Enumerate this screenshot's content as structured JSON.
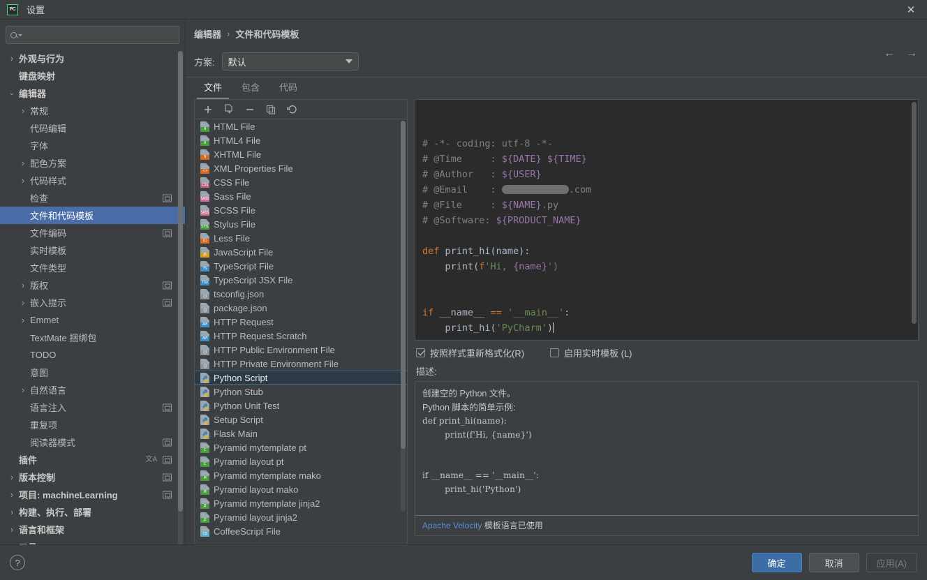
{
  "window": {
    "title": "设置",
    "app_icon": "PC",
    "close_icon": "✕"
  },
  "sidebar": {
    "search": {
      "placeholder": "",
      "value": "",
      "icon": "search-icon"
    },
    "items": [
      {
        "label": "外观与行为",
        "indent": 0,
        "arrow": "▶",
        "bold": true,
        "badge": false
      },
      {
        "label": "键盘映射",
        "indent": 0,
        "arrow": "",
        "bold": true,
        "badge": false
      },
      {
        "label": "编辑器",
        "indent": 0,
        "arrow": "▼",
        "bold": true,
        "badge": false
      },
      {
        "label": "常规",
        "indent": 1,
        "arrow": "▶",
        "bold": false,
        "badge": false
      },
      {
        "label": "代码编辑",
        "indent": 1,
        "arrow": "",
        "bold": false,
        "badge": false
      },
      {
        "label": "字体",
        "indent": 1,
        "arrow": "",
        "bold": false,
        "badge": false
      },
      {
        "label": "配色方案",
        "indent": 1,
        "arrow": "▶",
        "bold": false,
        "badge": false
      },
      {
        "label": "代码样式",
        "indent": 1,
        "arrow": "▶",
        "bold": false,
        "badge": false
      },
      {
        "label": "检查",
        "indent": 1,
        "arrow": "",
        "bold": false,
        "badge": true
      },
      {
        "label": "文件和代码模板",
        "indent": 1,
        "arrow": "",
        "bold": false,
        "badge": false,
        "selected": true
      },
      {
        "label": "文件编码",
        "indent": 1,
        "arrow": "",
        "bold": false,
        "badge": true
      },
      {
        "label": "实时模板",
        "indent": 1,
        "arrow": "",
        "bold": false,
        "badge": false
      },
      {
        "label": "文件类型",
        "indent": 1,
        "arrow": "",
        "bold": false,
        "badge": false
      },
      {
        "label": "版权",
        "indent": 1,
        "arrow": "▶",
        "bold": false,
        "badge": true
      },
      {
        "label": "嵌入提示",
        "indent": 1,
        "arrow": "▶",
        "bold": false,
        "badge": true
      },
      {
        "label": "Emmet",
        "indent": 1,
        "arrow": "▶",
        "bold": false,
        "badge": false
      },
      {
        "label": "TextMate 捆绑包",
        "indent": 1,
        "arrow": "",
        "bold": false,
        "badge": false
      },
      {
        "label": "TODO",
        "indent": 1,
        "arrow": "",
        "bold": false,
        "badge": false
      },
      {
        "label": "意图",
        "indent": 1,
        "arrow": "",
        "bold": false,
        "badge": false
      },
      {
        "label": "自然语言",
        "indent": 1,
        "arrow": "▶",
        "bold": false,
        "badge": false
      },
      {
        "label": "语言注入",
        "indent": 1,
        "arrow": "",
        "bold": false,
        "badge": true
      },
      {
        "label": "重复项",
        "indent": 1,
        "arrow": "",
        "bold": false,
        "badge": false
      },
      {
        "label": "阅读器模式",
        "indent": 1,
        "arrow": "",
        "bold": false,
        "badge": true
      },
      {
        "label": "插件",
        "indent": 0,
        "arrow": "",
        "bold": true,
        "badge": true,
        "translate": true
      },
      {
        "label": "版本控制",
        "indent": 0,
        "arrow": "▶",
        "bold": true,
        "badge": true
      },
      {
        "label": "项目: machineLearning",
        "indent": 0,
        "arrow": "▶",
        "bold": true,
        "badge": true
      },
      {
        "label": "构建、执行、部署",
        "indent": 0,
        "arrow": "▶",
        "bold": true,
        "badge": false
      },
      {
        "label": "语言和框架",
        "indent": 0,
        "arrow": "▶",
        "bold": true,
        "badge": false
      },
      {
        "label": "工具",
        "indent": 0,
        "arrow": "▶",
        "bold": true,
        "badge": false
      }
    ]
  },
  "header": {
    "breadcrumb": [
      "编辑器",
      "文件和代码模板"
    ],
    "breadcrumb_separator": "›",
    "back_icon": "←",
    "forward_icon": "→",
    "scheme_label": "方案:",
    "scheme_value": "默认"
  },
  "tabs": [
    {
      "label": "文件",
      "active": true
    },
    {
      "label": "包含",
      "active": false
    },
    {
      "label": "代码",
      "active": false
    }
  ],
  "list_toolbar": [
    {
      "icon": "add-icon",
      "glyph": "+"
    },
    {
      "icon": "copy-file-icon",
      "glyph": ""
    },
    {
      "icon": "remove-icon",
      "glyph": "−"
    },
    {
      "icon": "duplicate-icon",
      "glyph": ""
    },
    {
      "icon": "reset-icon",
      "glyph": "↺"
    }
  ],
  "templates": [
    {
      "label": "HTML File",
      "tag": "H",
      "color": "#4a9c3e"
    },
    {
      "label": "HTML4 File",
      "tag": "H",
      "color": "#4a9c3e"
    },
    {
      "label": "XHTML File",
      "tag": "H",
      "color": "#d46a20"
    },
    {
      "label": "XML Properties File",
      "tag": "<>",
      "color": "#d46a20"
    },
    {
      "label": "CSS File",
      "tag": "CSS",
      "color": "#c2627d"
    },
    {
      "label": "Sass File",
      "tag": "SASS",
      "color": "#cf6f93"
    },
    {
      "label": "SCSS File",
      "tag": "SASS",
      "color": "#cf6f93"
    },
    {
      "label": "Stylus File",
      "tag": "STYL",
      "color": "#4a9c3e"
    },
    {
      "label": "Less File",
      "tag": "(L)",
      "color": "#d46a20"
    },
    {
      "label": "JavaScript File",
      "tag": "JS",
      "color": "#d6a122"
    },
    {
      "label": "TypeScript File",
      "tag": "TS",
      "color": "#3a90c9"
    },
    {
      "label": "TypeScript JSX File",
      "tag": "TSX",
      "color": "#3a90c9"
    },
    {
      "label": "tsconfig.json",
      "tag": "{}",
      "color": "#8d9499"
    },
    {
      "label": "package.json",
      "tag": "{}",
      "color": "#8d9499"
    },
    {
      "label": "HTTP Request",
      "tag": "API",
      "color": "#3a90c9"
    },
    {
      "label": "HTTP Request Scratch",
      "tag": "API",
      "color": "#3a90c9"
    },
    {
      "label": "HTTP Public Environment File",
      "tag": "{}",
      "color": "#8d9499"
    },
    {
      "label": "HTTP Private Environment File",
      "tag": "{}",
      "color": "#8d9499"
    },
    {
      "label": "Python Script",
      "tag": "PY",
      "color": "#3a7cb8",
      "selected": true
    },
    {
      "label": "Python Stub",
      "tag": "PY",
      "color": "#3a7cb8"
    },
    {
      "label": "Python Unit Test",
      "tag": "PY",
      "color": "#3a7cb8"
    },
    {
      "label": "Setup Script",
      "tag": "PY",
      "color": "#3a7cb8"
    },
    {
      "label": "Flask Main",
      "tag": "PY",
      "color": "#3a7cb8"
    },
    {
      "label": "Pyramid mytemplate pt",
      "tag": "C",
      "color": "#4a9c3e"
    },
    {
      "label": "Pyramid layout pt",
      "tag": "C",
      "color": "#4a9c3e"
    },
    {
      "label": "Pyramid mytemplate mako",
      "tag": "M",
      "color": "#4a9c3e"
    },
    {
      "label": "Pyramid layout mako",
      "tag": "M",
      "color": "#4a9c3e"
    },
    {
      "label": "Pyramid mytemplate jinja2",
      "tag": "J2",
      "color": "#4a9c3e"
    },
    {
      "label": "Pyramid layout jinja2",
      "tag": "J2",
      "color": "#4a9c3e"
    },
    {
      "label": "CoffeeScript File",
      "tag": "CS",
      "color": "#5fb0c9"
    }
  ],
  "editor": {
    "lines": [
      [
        {
          "t": "# -*- coding: utf-8 -*-",
          "c": "cm"
        }
      ],
      [
        {
          "t": "# @Time     : ",
          "c": "cm"
        },
        {
          "t": "${DATE} ${TIME}",
          "c": "var"
        }
      ],
      [
        {
          "t": "# @Author   : ",
          "c": "cm"
        },
        {
          "t": "${USER}",
          "c": "var"
        }
      ],
      [
        {
          "t": "# @Email    : ",
          "c": "cm"
        },
        {
          "t": "REDACTED",
          "c": "redact"
        },
        {
          "t": ".com",
          "c": "cm"
        }
      ],
      [
        {
          "t": "# @File     : ",
          "c": "cm"
        },
        {
          "t": "${NAME}",
          "c": "var"
        },
        {
          "t": ".py",
          "c": "cm"
        }
      ],
      [
        {
          "t": "# @Software: ",
          "c": "cm"
        },
        {
          "t": "${PRODUCT_NAME}",
          "c": "var"
        }
      ],
      [],
      [
        {
          "t": "def ",
          "c": "kw"
        },
        {
          "t": "print_hi(name):",
          "c": "id"
        }
      ],
      [
        {
          "t": "    print(",
          "c": "id"
        },
        {
          "t": "f",
          "c": "kw"
        },
        {
          "t": "'Hi, ",
          "c": "str"
        },
        {
          "t": "{name}",
          "c": "var"
        },
        {
          "t": "')",
          "c": "str"
        }
      ],
      [],
      [],
      [
        {
          "t": "if ",
          "c": "kw"
        },
        {
          "t": "__name__ ",
          "c": "id"
        },
        {
          "t": "== ",
          "c": "kw"
        },
        {
          "t": "'__main__'",
          "c": "str"
        },
        {
          "t": ":",
          "c": "id"
        }
      ],
      [
        {
          "t": "    print_hi(",
          "c": "id"
        },
        {
          "t": "'PyCharm'",
          "c": "str"
        },
        {
          "t": ")",
          "c": "id"
        },
        {
          "t": "CARET",
          "c": "caret"
        }
      ]
    ]
  },
  "options": {
    "reformat": {
      "label": "按照样式重新格式化(R)",
      "checked": true
    },
    "live_template": {
      "label": "启用实时模板 (L)",
      "checked": false
    }
  },
  "description": {
    "label": "描述:",
    "lines": [
      {
        "text": "创建空的 Python 文件。",
        "mono": false
      },
      {
        "text": "Python 脚本的简单示例:",
        "mono": false
      },
      {
        "text": "def print_hi(name):",
        "mono": true
      },
      {
        "text": "        print(f'Hi, {name}')",
        "mono": true
      },
      {
        "text": "",
        "mono": true
      },
      {
        "text": "",
        "mono": true
      },
      {
        "text": "if __name__ == '__main__':",
        "mono": true
      },
      {
        "text": "        print_hi('Python')",
        "mono": true
      }
    ],
    "footer_link": "Apache Velocity",
    "footer_text": " 模板语言已使用"
  },
  "footer": {
    "help_icon": "?",
    "buttons": [
      {
        "label": "确定",
        "style": "primary"
      },
      {
        "label": "取消",
        "style": "normal"
      },
      {
        "label": "应用(A)",
        "style": "disabled"
      }
    ]
  },
  "colors": {
    "accent": "#4a6da7",
    "primary_button": "#3c6ea5",
    "selection": "#2d3a46",
    "link": "#5b8cd6"
  }
}
